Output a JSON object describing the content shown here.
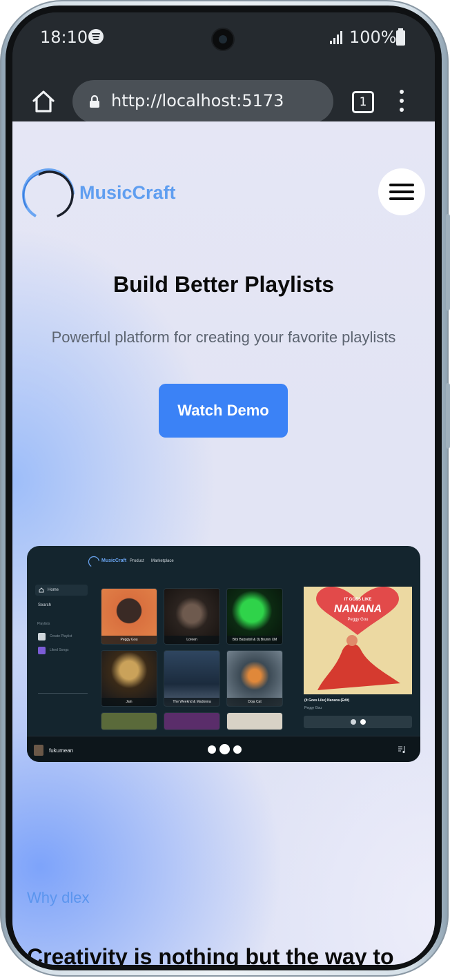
{
  "status_bar": {
    "time": "18:10",
    "battery": "100%",
    "icons": [
      "spotify-icon",
      "signal-icon",
      "battery-icon"
    ]
  },
  "browser": {
    "url": "http://localhost:5173",
    "tab_count": "1",
    "icons": [
      "home-icon",
      "lock-icon",
      "tabs-icon",
      "more-options-icon"
    ]
  },
  "navbar": {
    "brand": "MusicCraft",
    "menu_icon": "hamburger-menu-icon"
  },
  "hero": {
    "title": "Build Better Playlists",
    "subtitle": "Powerful platform for creating your favorite playlists",
    "cta_label": "Watch Demo",
    "cta_color": "#3b82f6"
  },
  "preview": {
    "brand": "MusicCraft",
    "nav": [
      "Product",
      "Marketplace"
    ],
    "sidebar": {
      "home": "Home",
      "search": "Search",
      "section": "Playlists",
      "create": "Create Playlist",
      "liked": "Liked Songs"
    },
    "tiles": [
      "Peggy Gou",
      "Loreen",
      "Bibi Babydoll & Dj Brunin XM",
      "Jain",
      "The Weeknd & Madonna",
      "Doja Cat"
    ],
    "now_playing": {
      "art_line1": "IT GOES LIKE",
      "art_line2": "NANANA",
      "art_artist": "Peggy Gou",
      "title": "(It Goes Like) Nanana (Edit)",
      "artist": "Peggy Gou"
    },
    "player": {
      "user": "fukumean"
    }
  },
  "why": {
    "label": "Why dlex",
    "heading": "Creativity is nothing but the way to"
  },
  "colors": {
    "brand_blue": "#5f9ef0",
    "link_blue": "#5b95ee",
    "browser_chrome": "#252a2f"
  }
}
